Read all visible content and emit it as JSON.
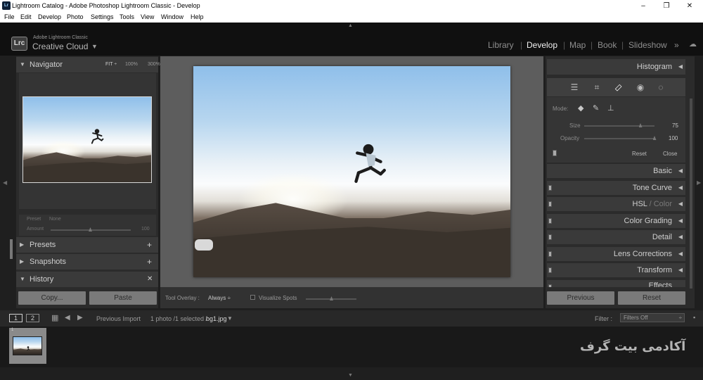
{
  "window": {
    "title": "Lightroom Catalog - Adobe Photoshop Lightroom Classic - Develop",
    "minimize": "–",
    "maximize": "❐",
    "close": "✕"
  },
  "menu": [
    "File",
    "Edit",
    "Develop",
    "Photo",
    "Settings",
    "Tools",
    "View",
    "Window",
    "Help"
  ],
  "brand": {
    "badge": "Lrc",
    "line1": "Adobe Lightroom Classic",
    "line2": "Creative Cloud"
  },
  "modules": {
    "library": "Library",
    "develop": "Develop",
    "map": "Map",
    "book": "Book",
    "slideshow": "Slideshow",
    "more": "»"
  },
  "navigator": {
    "title": "Navigator",
    "fit": "FIT ÷",
    "z100": "100%",
    "z300": "300%"
  },
  "preset_amount": {
    "preset_label": "Preset",
    "preset_value": "None",
    "amount_label": "Amount",
    "amount_value": "100"
  },
  "left_sections": {
    "presets": "Presets",
    "snapshots": "Snapshots",
    "history": "History",
    "plus": "+",
    "x": "✕"
  },
  "left_buttons": {
    "copy": "Copy...",
    "paste": "Paste"
  },
  "toolbar": {
    "tool_overlay_label": "Tool Overlay :",
    "tool_overlay_value": "Always ÷",
    "visualize_spots": "Visualize Spots"
  },
  "right": {
    "histogram": "Histogram",
    "mode_label": "Mode:",
    "size_label": "Size",
    "size_value": "75",
    "size_fraction": 0.8,
    "opacity_label": "Opacity",
    "opacity_value": "100",
    "opacity_fraction": 1.0,
    "reset": "Reset",
    "close": "Close",
    "sections": [
      "Basic",
      "Tone Curve",
      "HSL",
      "Color",
      "Color Grading",
      "Detail",
      "Lens Corrections",
      "Transform",
      "Effects"
    ],
    "hsl_sep": " / ",
    "previous": "Previous",
    "reset_button": "Reset"
  },
  "filmbar": {
    "view1": "1",
    "view2": "2",
    "source": "Previous Import",
    "count": "1 photo /1 selected /",
    "filename": "bg1.jpg",
    "filter_label": "Filter :",
    "filter_value": "Filters Off",
    "thumb_index": "1"
  },
  "watermark": "آکادمی بیت گرف"
}
